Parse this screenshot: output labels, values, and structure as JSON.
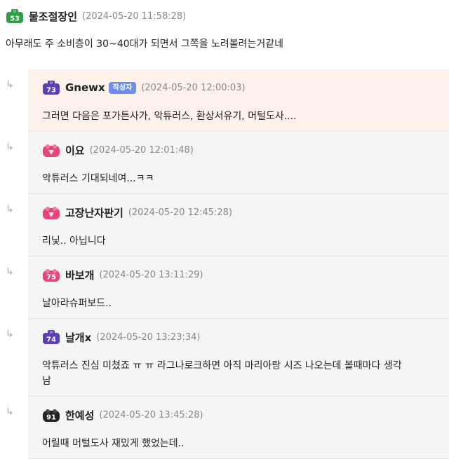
{
  "top_comment": {
    "level": "53",
    "badge_color": "#2f9e45",
    "nickname": "물조절장인",
    "timestamp": "(2024-05-20 11:58:28)",
    "text": "아무래도 주 소비층이 30~40대가 되면서 그쪽을 노려볼려는거같네"
  },
  "replies": [
    {
      "level": "73",
      "badge_color": "#5b3fb6",
      "nickname": "Gnewx",
      "author_tag": "작성자",
      "timestamp": "(2024-05-20 12:00:03)",
      "text": "그러면 다음은 포가튼사가, 악튜러스, 환상서유기, 머털도사....",
      "highlight": true
    },
    {
      "level": "",
      "badge_color": "#e8457a",
      "nickname": "이요",
      "timestamp": "(2024-05-20 12:01:48)",
      "text": "악튜러스 기대되네여...ㅋㅋ"
    },
    {
      "level": "",
      "badge_color": "#e8457a",
      "nickname": "고장난자판기",
      "timestamp": "(2024-05-20 12:45:28)",
      "text": "리닟.. 아닙니다"
    },
    {
      "level": "75",
      "badge_color": "#e8457a",
      "nickname": "바보개",
      "timestamp": "(2024-05-20 13:11:29)",
      "text": "날아라슈퍼보드.."
    },
    {
      "level": "74",
      "badge_color": "#5b3fb6",
      "nickname": "날개x",
      "timestamp": "(2024-05-20 13:23:34)",
      "text": "악튜러스 진심 미쳤죠 ㅠ ㅠ 라그나로크하면 아직 마리아랑 시즈 나오는데 볼때마다 생각",
      "text_line2": "남"
    },
    {
      "level": "91",
      "badge_color": "#222222",
      "nickname": "한예성",
      "timestamp": "(2024-05-20 13:45:28)",
      "text": "어릴때 머털도사 재밌게 했었는데.."
    }
  ],
  "reply_arrow": "↳"
}
